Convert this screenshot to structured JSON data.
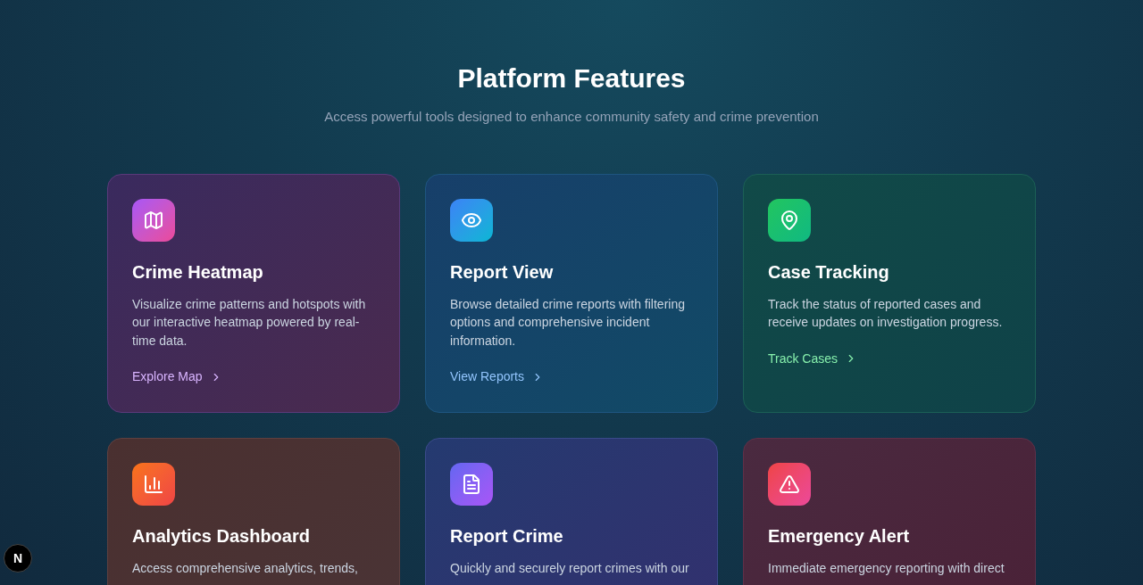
{
  "header": {
    "title": "Platform Features",
    "subtitle": "Access powerful tools designed to enhance community safety and crime prevention"
  },
  "features": [
    {
      "title": "Crime Heatmap",
      "description": "Visualize crime patterns and hotspots with our interactive heatmap powered by real-time data.",
      "link": "Explore Map"
    },
    {
      "title": "Report View",
      "description": "Browse detailed crime reports with filtering options and comprehensive incident information.",
      "link": "View Reports"
    },
    {
      "title": "Case Tracking",
      "description": "Track the status of reported cases and receive updates on investigation progress.",
      "link": "Track Cases"
    },
    {
      "title": "Analytics Dashboard",
      "description": "Access comprehensive analytics, trends,"
    },
    {
      "title": "Report Crime",
      "description": "Quickly and securely report crimes with our"
    },
    {
      "title": "Emergency Alert",
      "description": "Immediate emergency reporting with direct"
    }
  ],
  "dev_badge": "N"
}
